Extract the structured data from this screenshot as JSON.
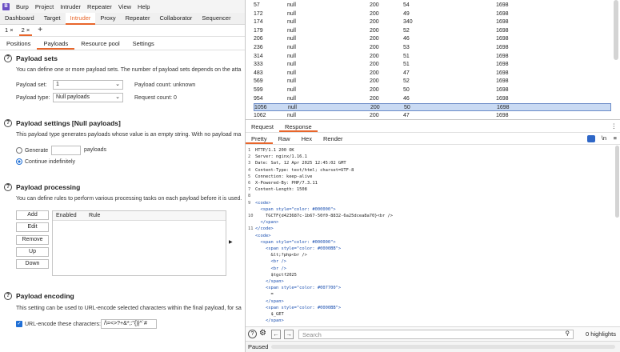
{
  "menu": {
    "items": [
      "Burp",
      "Project",
      "Intruder",
      "Repeater",
      "View",
      "Help"
    ]
  },
  "top_tabs": [
    "Dashboard",
    "Target",
    "Intruder",
    "Proxy",
    "Repeater",
    "Collaborator",
    "Sequencer"
  ],
  "intruder_tabs": [
    "1 ×",
    "2 ×",
    "+"
  ],
  "sub_tabs": [
    "Positions",
    "Payloads",
    "Resource pool",
    "Settings"
  ],
  "payload_sets": {
    "title": "Payload sets",
    "desc": "You can define one or more payload sets. The number of payload sets depends on the atta",
    "set_label": "Payload set:",
    "set_value": "1",
    "type_label": "Payload type:",
    "type_value": "Null payloads",
    "count_label": "Payload count: unknown",
    "request_label": "Request count: 0"
  },
  "payload_settings": {
    "title": "Payload settings [Null payloads]",
    "desc": "This payload type generates payloads whose value is an empty string. With no payload ma",
    "generate": "Generate",
    "payloads": "payloads",
    "continue": "Continue indefinitely"
  },
  "payload_processing": {
    "title": "Payload processing",
    "desc": "You can define rules to perform various processing tasks on each payload before it is used.",
    "buttons": [
      "Add",
      "Edit",
      "Remove",
      "Up",
      "Down"
    ],
    "col_enabled": "Enabled",
    "col_rule": "Rule"
  },
  "payload_encoding": {
    "title": "Payload encoding",
    "desc": "This setting can be used to URL-encode selected characters within the final payload, for sa",
    "checkbox_label": "URL-encode these characters:",
    "chars": "/\\=<>?+&*;:\"{}|^`#"
  },
  "results": [
    [
      "57",
      "null",
      "200",
      "54",
      "1698"
    ],
    [
      "172",
      "null",
      "200",
      "49",
      "1698"
    ],
    [
      "174",
      "null",
      "200",
      "340",
      "1698"
    ],
    [
      "179",
      "null",
      "200",
      "52",
      "1698"
    ],
    [
      "206",
      "null",
      "200",
      "46",
      "1698"
    ],
    [
      "236",
      "null",
      "200",
      "53",
      "1698"
    ],
    [
      "314",
      "null",
      "200",
      "51",
      "1698"
    ],
    [
      "333",
      "null",
      "200",
      "51",
      "1698"
    ],
    [
      "483",
      "null",
      "200",
      "47",
      "1698"
    ],
    [
      "569",
      "null",
      "200",
      "52",
      "1698"
    ],
    [
      "599",
      "null",
      "200",
      "50",
      "1698"
    ],
    [
      "954",
      "null",
      "200",
      "46",
      "1698"
    ],
    [
      "1056",
      "null",
      "200",
      "50",
      "1698"
    ],
    [
      "1062",
      "null",
      "200",
      "47",
      "1698"
    ]
  ],
  "selected_row": "1056",
  "req_tabs": [
    "Request",
    "Response"
  ],
  "view_tabs": [
    "Pretty",
    "Raw",
    "Hex",
    "Render"
  ],
  "view_icons": [
    "\\n",
    "≡"
  ],
  "code_lines": [
    {
      "n": "1",
      "t": "HTTP/1.1 200 OK"
    },
    {
      "n": "2",
      "t": "Server: nginx/1.16.1"
    },
    {
      "n": "3",
      "t": "Date: Sat, 12 Apr 2025 12:45:02 GMT"
    },
    {
      "n": "4",
      "t": "Content-Type: text/html; charset=UTF-8"
    },
    {
      "n": "5",
      "t": "Connection: keep-alive"
    },
    {
      "n": "6",
      "t": "X-Powered-By: PHP/7.3.11"
    },
    {
      "n": "7",
      "t": "Content-Length: 1508"
    },
    {
      "n": "8",
      "t": ""
    },
    {
      "n": "9",
      "t": "<code>"
    },
    {
      "n": "",
      "t": "  <span style=\"color: #000000\">"
    },
    {
      "n": "10",
      "t": "    TGCTF{d423687c-1b67-50f0-8832-6a25dcea8a70}<br />"
    },
    {
      "n": "",
      "t": "  </span>"
    },
    {
      "n": "11",
      "t": "</code>"
    },
    {
      "n": "",
      "t": "<code>"
    },
    {
      "n": "",
      "t": "  <span style=\"color: #000000\">"
    },
    {
      "n": "",
      "t": "    <span style=\"color: #0000BB\">"
    },
    {
      "n": "",
      "t": "      &lt;?php<br />"
    },
    {
      "n": "",
      "t": "      <br />"
    },
    {
      "n": "",
      "t": "      <br />"
    },
    {
      "n": "",
      "t": "      $tgctf2025"
    },
    {
      "n": "",
      "t": "    </span>"
    },
    {
      "n": "",
      "t": "    <span style=\"color: #007700\">"
    },
    {
      "n": "",
      "t": "      ="
    },
    {
      "n": "",
      "t": "    </span>"
    },
    {
      "n": "",
      "t": "    <span style=\"color: #0000BB\">"
    },
    {
      "n": "",
      "t": "      $_GET"
    },
    {
      "n": "",
      "t": "    </span>"
    }
  ],
  "search": {
    "placeholder": "Search",
    "highlights": "0 highlights"
  },
  "status": "Paused"
}
